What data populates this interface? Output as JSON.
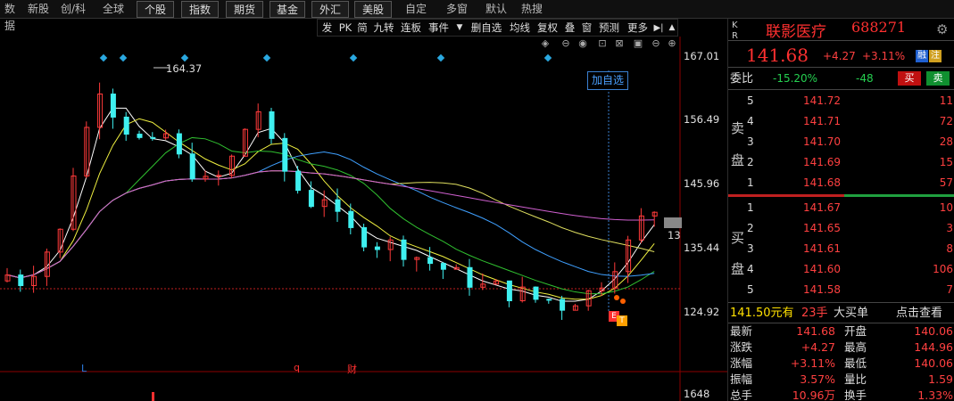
{
  "nav": {
    "items": [
      "数据",
      "新股",
      "创/科",
      "全球",
      "个股",
      "指数",
      "期货",
      "基金",
      "外汇",
      "美股",
      "自定",
      "多窗",
      "默认",
      "热搜"
    ]
  },
  "toolbar": {
    "items": [
      "发",
      "PK",
      "简",
      "九转",
      "连板",
      "事件",
      "删自选",
      "均线",
      "复权",
      "叠",
      "窗",
      "预测",
      "更多"
    ]
  },
  "chart": {
    "high_label": "164.37",
    "y_labels": [
      "167.01",
      "156.49",
      "145.96",
      "135.44",
      "124.92"
    ],
    "volume_label": "1648",
    "last_price_tag": "13",
    "add_watch": "加自选",
    "markers": {
      "l": "L",
      "q": "q",
      "cai": "财",
      "e": "E",
      "t": "T"
    }
  },
  "chart_data": {
    "type": "candlestick",
    "y_ticks": [
      167.01,
      156.49,
      145.96,
      135.44,
      124.92
    ],
    "high_annotation": 164.37,
    "last": 141.68
  },
  "quote": {
    "kr": "K\nR",
    "name": "联影医疗",
    "code": "688271",
    "price": "141.68",
    "change": "+4.27",
    "change_pct": "+3.11%",
    "tags": [
      "融",
      "注"
    ],
    "weibi_label": "委比",
    "weibi_pct": "-15.20%",
    "weibi_diff": "-48",
    "sell_btn": "买",
    "buy_btn": "卖",
    "sell_label": "卖盘",
    "buy_label": "买盘",
    "asks": [
      {
        "lvl": "5",
        "price": "141.72",
        "vol": "11"
      },
      {
        "lvl": "4",
        "price": "141.71",
        "vol": "72"
      },
      {
        "lvl": "3",
        "price": "141.70",
        "vol": "28"
      },
      {
        "lvl": "2",
        "price": "141.69",
        "vol": "15"
      },
      {
        "lvl": "1",
        "price": "141.68",
        "vol": "57"
      }
    ],
    "bids": [
      {
        "lvl": "1",
        "price": "141.67",
        "vol": "10"
      },
      {
        "lvl": "2",
        "price": "141.65",
        "vol": "3"
      },
      {
        "lvl": "3",
        "price": "141.61",
        "vol": "8"
      },
      {
        "lvl": "4",
        "price": "141.60",
        "vol": "106"
      },
      {
        "lvl": "5",
        "price": "141.58",
        "vol": "7"
      }
    ],
    "big_order": {
      "amount": "141.50元有",
      "hands": "23手",
      "label": "大买单",
      "action": "点击查看"
    },
    "stats": [
      {
        "k1": "最新",
        "v1": "141.68",
        "k2": "开盘",
        "v2": "140.06"
      },
      {
        "k1": "涨跌",
        "v1": "+4.27",
        "k2": "最高",
        "v2": "144.96"
      },
      {
        "k1": "涨幅",
        "v1": "+3.11%",
        "k2": "最低",
        "v2": "140.06"
      },
      {
        "k1": "振幅",
        "v1": "3.57%",
        "k2": "量比",
        "v2": "1.59"
      },
      {
        "k1": "总手",
        "v1": "10.96万",
        "k2": "换手",
        "v2": "1.33%"
      }
    ]
  }
}
